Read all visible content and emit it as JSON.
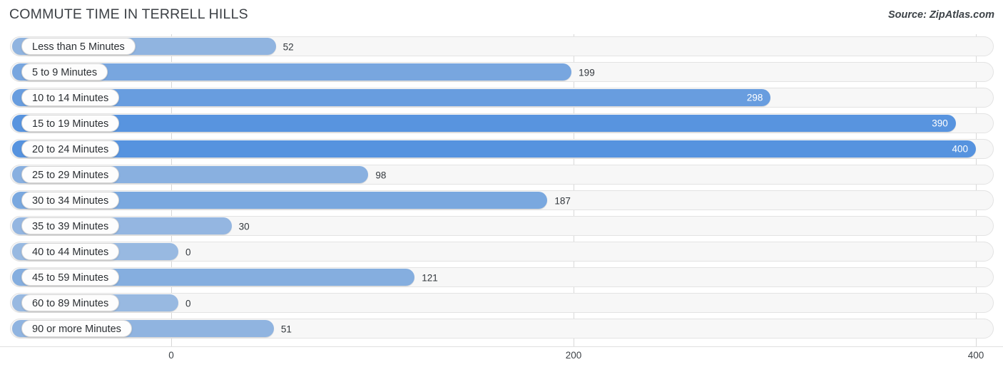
{
  "header": {
    "title": "COMMUTE TIME IN TERRELL HILLS",
    "source": "Source: ZipAtlas.com"
  },
  "chart_data": {
    "type": "bar",
    "orientation": "horizontal",
    "title": "COMMUTE TIME IN TERRELL HILLS",
    "xlabel": "",
    "ylabel": "",
    "xlim": [
      0,
      400
    ],
    "xticks": [
      0,
      200,
      400
    ],
    "xtick_labels": [
      "0",
      "200",
      "400"
    ],
    "grid": true,
    "legend": null,
    "bar_color": "#6fa5de",
    "track_color": "#f7f7f7",
    "categories": [
      "Less than 5 Minutes",
      "5 to 9 Minutes",
      "10 to 14 Minutes",
      "15 to 19 Minutes",
      "20 to 24 Minutes",
      "25 to 29 Minutes",
      "30 to 34 Minutes",
      "35 to 39 Minutes",
      "40 to 44 Minutes",
      "45 to 59 Minutes",
      "60 to 89 Minutes",
      "90 or more Minutes"
    ],
    "values": [
      52,
      199,
      298,
      390,
      400,
      98,
      187,
      30,
      0,
      121,
      0,
      51
    ],
    "value_labels": [
      "52",
      "199",
      "298",
      "390",
      "400",
      "98",
      "187",
      "30",
      "0",
      "121",
      "0",
      "51"
    ]
  }
}
